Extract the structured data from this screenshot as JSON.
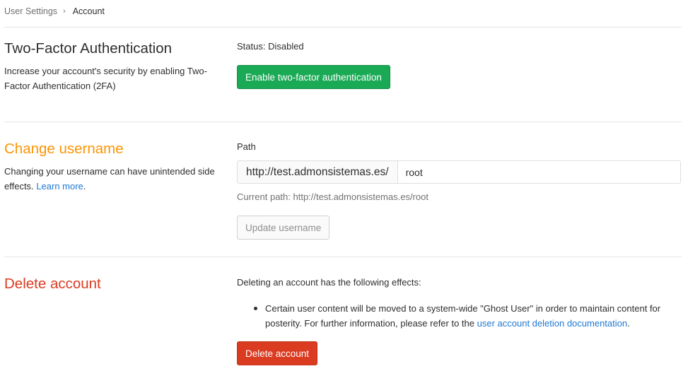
{
  "breadcrumb": {
    "parent": "User Settings",
    "separator": "›",
    "current": "Account"
  },
  "two_factor": {
    "title": "Two-Factor Authentication",
    "description": "Increase your account's security by enabling Two-Factor Authentication (2FA)",
    "status": "Status: Disabled",
    "button_label": "Enable two-factor authentication",
    "title_color": "#2e2e2e",
    "button_color": "#1aaa55"
  },
  "change_username": {
    "title": "Change username",
    "title_color": "#fc9403",
    "description": "Changing your username can have unintended side effects.",
    "learn_more": "Learn more",
    "period": ".",
    "path_label": "Path",
    "path_prefix": "http://test.admonsistemas.es/",
    "username_value": "root",
    "current_path": "Current path: http://test.admonsistemas.es/root",
    "button_label": "Update username"
  },
  "delete_account": {
    "title": "Delete account",
    "title_color": "#db3b21",
    "intro": "Deleting an account has the following effects:",
    "effects": [
      {
        "text": "Certain user content will be moved to a system-wide \"Ghost User\" in order to maintain content for posterity. For further information, please refer to the ",
        "link": "user account deletion documentation",
        "suffix": "."
      }
    ],
    "button_label": "Delete account",
    "button_color": "#db3b21"
  },
  "link_color": "#1f78d1"
}
